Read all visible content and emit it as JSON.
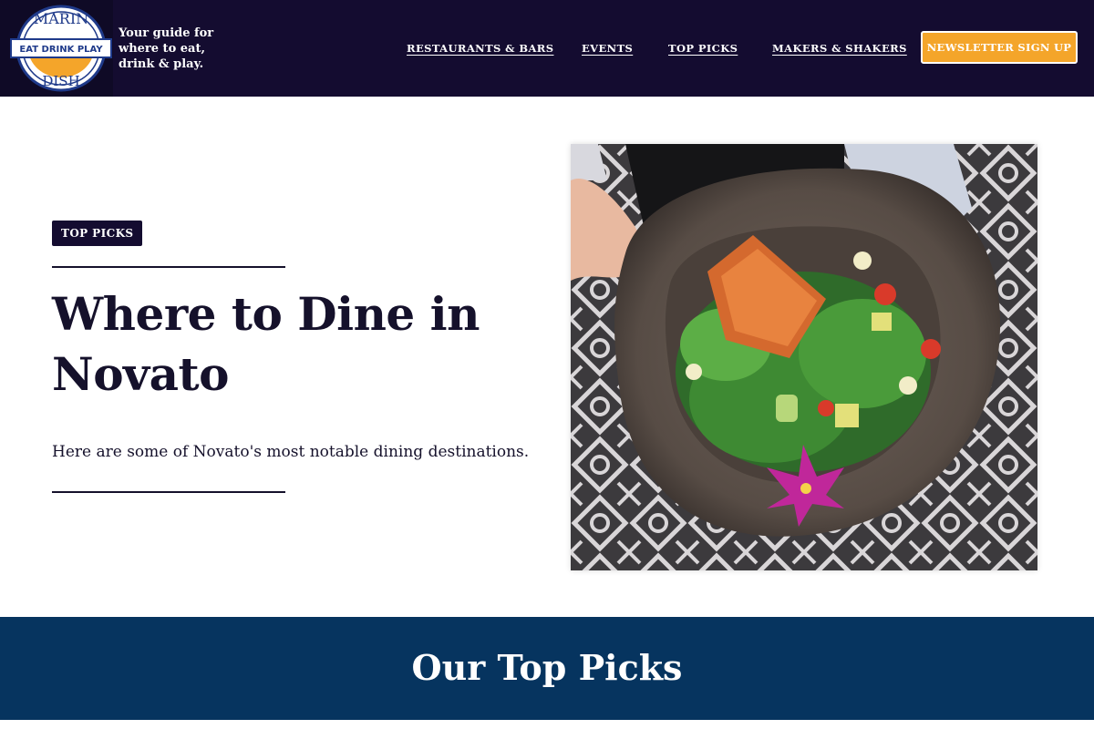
{
  "header": {
    "logo": {
      "top_text": "MARIN",
      "middle_text": "EAT DRINK PLAY",
      "bottom_text": "DISH"
    },
    "tagline": "Your guide for where to eat, drink & play.",
    "nav": [
      {
        "label": "RESTAURANTS & BARS"
      },
      {
        "label": "EVENTS"
      },
      {
        "label": "TOP PICKS"
      },
      {
        "label": "MAKERS & SHAKERS"
      }
    ],
    "newsletter_label": "NEWSLETTER SIGN UP"
  },
  "hero": {
    "badge": "TOP PICKS",
    "title": "Where to Dine in Novato",
    "subtitle": "Here are some of Novato's most notable dining destinations."
  },
  "band": {
    "title": "Our Top Picks"
  },
  "colors": {
    "header_bg": "#140c30",
    "accent_orange": "#f4a52a",
    "band_blue": "#06345f",
    "text_dark": "#15112b"
  }
}
